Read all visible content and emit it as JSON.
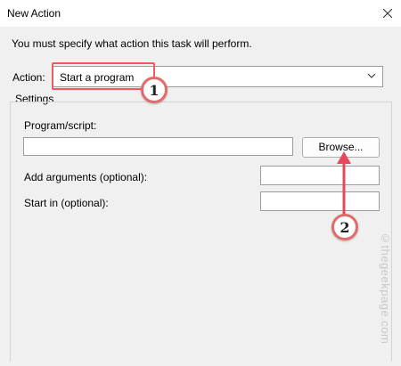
{
  "window": {
    "title": "New Action",
    "close_icon": "close-icon"
  },
  "instruction": "You must specify what action this task will perform.",
  "action": {
    "label": "Action:",
    "selected": "Start a program"
  },
  "settings": {
    "label": "Settings",
    "program_label": "Program/script:",
    "program_value": "",
    "browse_label": "Browse...",
    "args_label": "Add arguments (optional):",
    "args_value": "",
    "start_label": "Start in (optional):",
    "start_value": ""
  },
  "annotations": {
    "badge_1": "1",
    "badge_2": "2",
    "highlight_color": "#f05a5a",
    "arrow_color": "#e8495a"
  },
  "watermark": "©thegeekpage.com"
}
